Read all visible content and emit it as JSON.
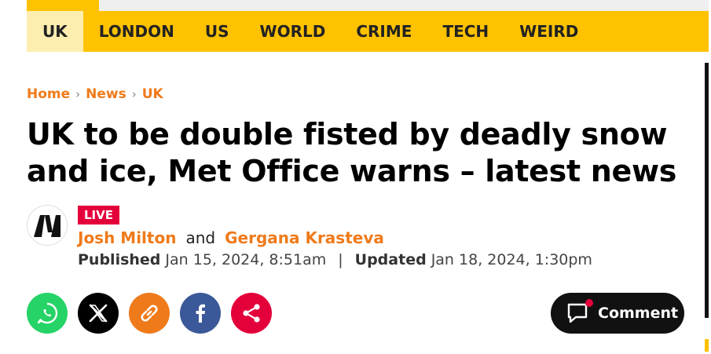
{
  "nav": {
    "items": [
      {
        "label": "UK"
      },
      {
        "label": "LONDON"
      },
      {
        "label": "US"
      },
      {
        "label": "WORLD"
      },
      {
        "label": "CRIME"
      },
      {
        "label": "TECH"
      },
      {
        "label": "WEIRD"
      }
    ],
    "active": "UK"
  },
  "breadcrumb": {
    "items": [
      "Home",
      "News",
      "UK"
    ],
    "separator": "›"
  },
  "article": {
    "headline": "UK to be double fisted by deadly snow and ice, Met Office warns – latest news",
    "live_label": "LIVE",
    "authors": [
      "Josh Milton",
      "Gergana Krasteva"
    ],
    "author_joiner": "and",
    "published_label": "Published",
    "published_date": "Jan 15, 2024, 8:51am",
    "updated_label": "Updated",
    "updated_date": "Jan 18, 2024, 1:30pm",
    "date_separator": "|"
  },
  "share": {
    "buttons": [
      {
        "icon": "whatsapp-icon",
        "color": "#25d366"
      },
      {
        "icon": "x-icon",
        "color": "#000000"
      },
      {
        "icon": "link-icon",
        "color": "#ef7a1a"
      },
      {
        "icon": "facebook-icon",
        "color": "#3b5998"
      },
      {
        "icon": "share-icon",
        "color": "#e4003b"
      }
    ]
  },
  "comment": {
    "label": "Comment",
    "icon": "comment-icon"
  },
  "colors": {
    "brand_yellow": "#ffc200",
    "link_orange": "#ef7a1a",
    "live_red": "#e4003b"
  }
}
